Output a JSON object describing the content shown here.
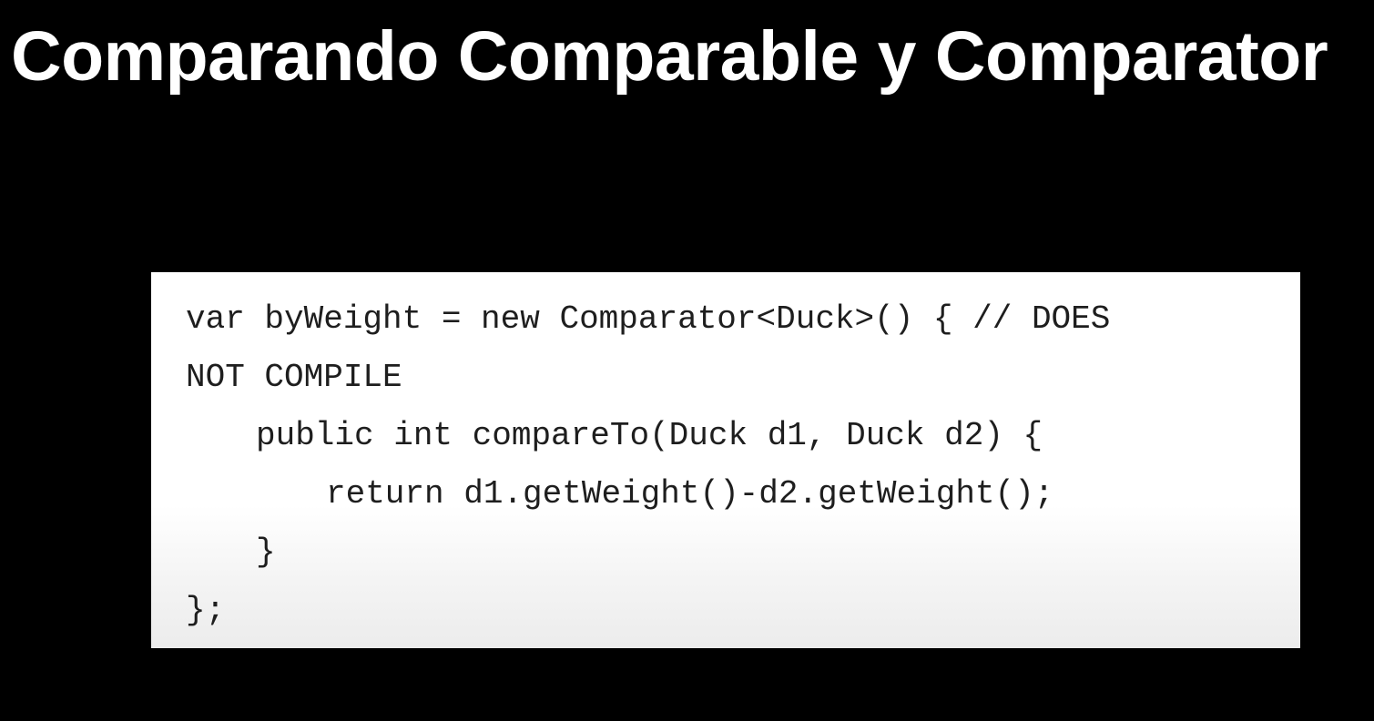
{
  "slide": {
    "title": "Comparando Comparable y Comparator"
  },
  "code": {
    "lines": [
      {
        "text": "var byWeight = new Comparator<Duck>() { // DOES",
        "indent": 0
      },
      {
        "text": "NOT COMPILE",
        "indent": 0
      },
      {
        "text": "public int compareTo(Duck d1, Duck d2) {",
        "indent": 1
      },
      {
        "text": "return d1.getWeight()-d2.getWeight();",
        "indent": 2
      },
      {
        "text": "}",
        "indent": 1
      },
      {
        "text": "};",
        "indent": 0
      }
    ]
  },
  "colors": {
    "background": "#000000",
    "title_text": "#ffffff",
    "code_background": "#ffffff",
    "code_text": "#1e1e1e"
  }
}
